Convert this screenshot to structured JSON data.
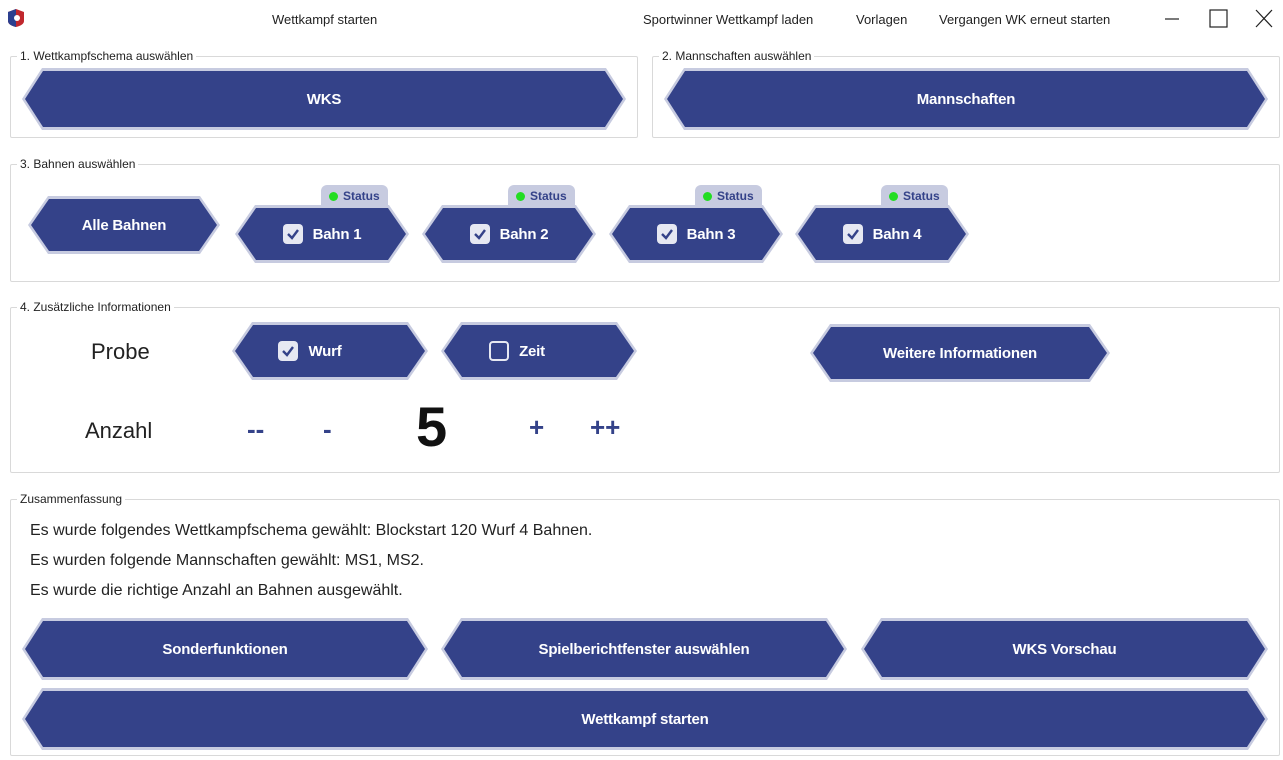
{
  "window": {
    "title": "Wettkampf starten",
    "menu": [
      "Sportwinner Wettkampf laden",
      "Vorlagen",
      "Vergangen WK erneut starten"
    ],
    "controls": [
      "minimize-icon",
      "maximize-icon",
      "close-icon"
    ]
  },
  "groups": {
    "schema": {
      "legend": "1. Wettkampfschema auswählen",
      "button": "WKS"
    },
    "teams": {
      "legend": "2. Mannschaften auswählen",
      "button": "Mannschaften"
    },
    "lanes": {
      "legend": "3. Bahnen auswählen",
      "all_button": "Alle Bahnen",
      "items": [
        {
          "label": "Bahn 1",
          "checked": true,
          "status": "Status",
          "status_color": "#22dd22"
        },
        {
          "label": "Bahn 2",
          "checked": true,
          "status": "Status",
          "status_color": "#22dd22"
        },
        {
          "label": "Bahn 3",
          "checked": true,
          "status": "Status",
          "status_color": "#22dd22"
        },
        {
          "label": "Bahn 4",
          "checked": true,
          "status": "Status",
          "status_color": "#22dd22"
        }
      ]
    },
    "extra": {
      "legend": "4. Zusätzliche Informationen",
      "probe_label": "Probe",
      "wurf": {
        "label": "Wurf",
        "checked": true
      },
      "zeit": {
        "label": "Zeit",
        "checked": false
      },
      "more_button": "Weitere Informationen",
      "anzahl_label": "Anzahl",
      "dec_big": "--",
      "dec": "-",
      "count": "5",
      "inc": "+",
      "inc_big": "++"
    },
    "summary": {
      "legend": "Zusammenfassung",
      "lines": [
        "Es wurde folgendes Wettkampfschema gewählt: Blockstart 120 Wurf 4 Bahnen.",
        "Es wurden folgende Mannschaften gewählt: MS1, MS2.",
        "Es wurde die richtige Anzahl an Bahnen ausgewählt."
      ],
      "buttons": {
        "special": "Sonderfunktionen",
        "report": "Spielberichtfenster auswählen",
        "preview": "WKS Vorschau",
        "start": "Wettkampf starten"
      }
    }
  },
  "colors": {
    "accent": "#344289",
    "accent_border": "#c7cbe0",
    "status_ok": "#22dd22"
  }
}
